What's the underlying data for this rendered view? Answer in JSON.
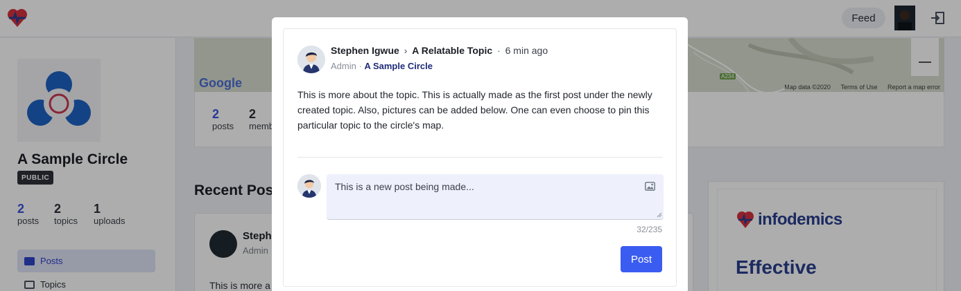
{
  "topbar": {
    "feed_label": "Feed"
  },
  "sidebar": {
    "circle_name": "A Sample Circle",
    "visibility_badge": "PUBLIC",
    "stats": [
      {
        "value": "2",
        "label": "posts"
      },
      {
        "value": "2",
        "label": "topics"
      },
      {
        "value": "1",
        "label": "uploads"
      }
    ],
    "nav": [
      {
        "label": "Posts",
        "active": true
      },
      {
        "label": "Topics",
        "active": false
      }
    ]
  },
  "map": {
    "brand": "Google",
    "road_label": "A234",
    "credits": [
      "Map data ©2020",
      "Terms of Use",
      "Report a map error"
    ]
  },
  "stats_card": {
    "posts_value": "2",
    "posts_label": "posts",
    "members_value": "2",
    "members_label": "memb"
  },
  "recent": {
    "title": "Recent Pos",
    "post_author": "Stephe",
    "post_role": "Admin",
    "post_text": "This is more a"
  },
  "ad": {
    "brand": "infodemics",
    "headline": "Effective"
  },
  "modal": {
    "author": "Stephen Igwue",
    "arrow": "›",
    "topic": "A Relatable Topic",
    "dot": "·",
    "time": "6 min ago",
    "role": "Admin",
    "circle": "A Sample Circle",
    "body": "This is more about the topic. This is actually made as the first post under the newly created topic. Also, pictures can be added below. One can even choose to pin this particular topic to the circle's map.",
    "comment_text": "This is a new post being made...",
    "char_count": "32/235",
    "post_button": "Post"
  },
  "colors": {
    "accent": "#3b5cf0",
    "brand_red": "#d6323f",
    "brand_blue": "#2a3f8f"
  }
}
